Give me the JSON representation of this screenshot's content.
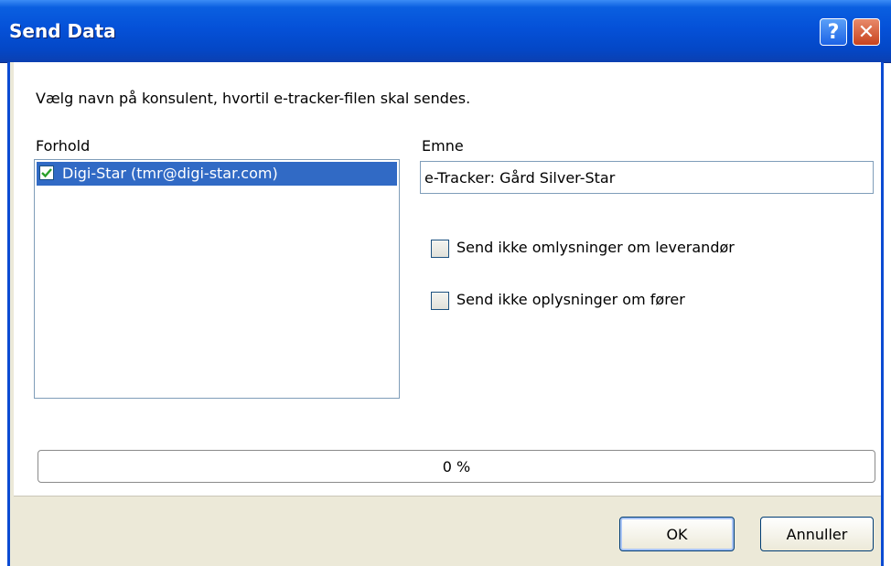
{
  "window": {
    "title": "Send Data",
    "help_symbol": "?",
    "close_symbol": "✕"
  },
  "instruction": "Vælg navn på konsulent, hvortil e-tracker-filen skal sendes.",
  "forhold": {
    "label": "Forhold",
    "items": [
      {
        "label": "Digi-Star (tmr@digi-star.com)",
        "checked": true
      }
    ]
  },
  "emne": {
    "label": "Emne",
    "value": "e-Tracker: Gård Silver-Star"
  },
  "options": [
    {
      "label": "Send ikke omlysninger om leverandør",
      "checked": false
    },
    {
      "label": "Send ikke oplysninger om fører",
      "checked": false
    }
  ],
  "progress": {
    "fraction": 0,
    "text": "0 %"
  },
  "buttons": {
    "ok": "OK",
    "cancel": "Annuller"
  },
  "colors": {
    "titlebar": "#0551d8",
    "selection": "#316ac5",
    "check": "#2aa02a"
  },
  "icons": {
    "help": "help-icon",
    "close": "close-icon",
    "checkmark": "checkmark-icon"
  }
}
